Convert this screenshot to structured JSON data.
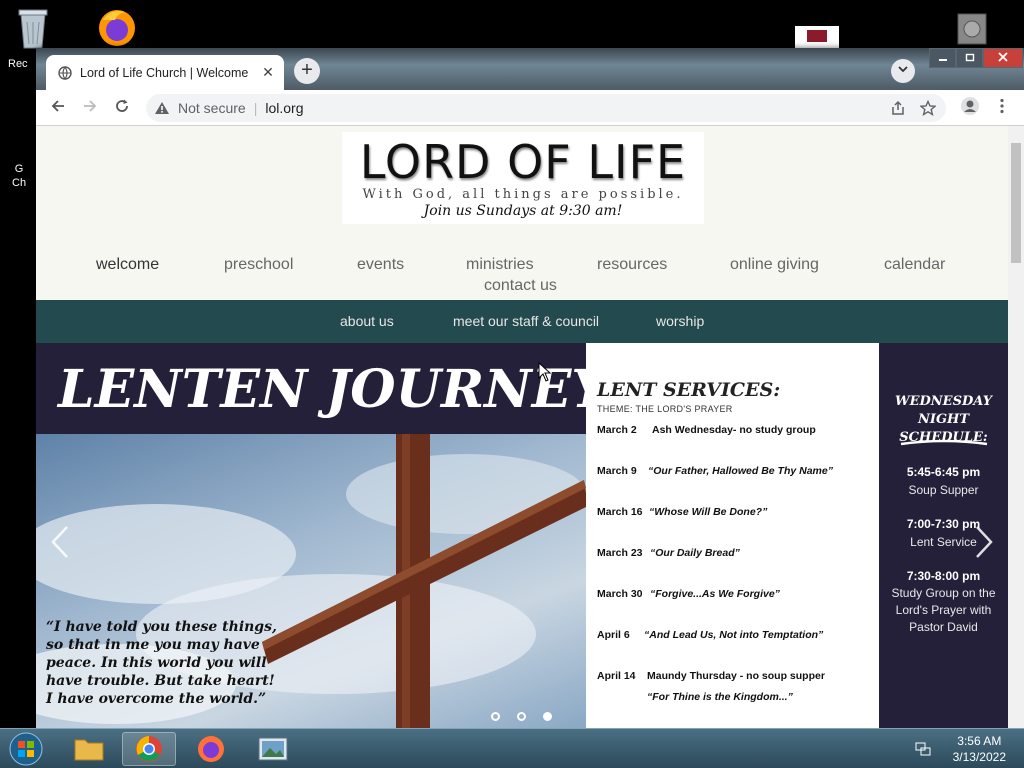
{
  "desktop": {
    "icons": [
      {
        "label": "Rec"
      },
      {
        "label": "G\nCh"
      }
    ]
  },
  "browser": {
    "tab_title": "Lord of Life Church | Welcome",
    "address_security": "Not secure",
    "address_url": "lol.org"
  },
  "site": {
    "logo_title": "LORD OF LIFE",
    "logo_tagline": "With God, all things are possible.",
    "logo_join": "Join us Sundays at 9:30 am!",
    "nav": [
      "welcome",
      "preschool",
      "events",
      "ministries",
      "resources",
      "online giving",
      "calendar",
      "contact us"
    ],
    "subnav": [
      "about us",
      "meet our staff & council",
      "worship"
    ]
  },
  "slide": {
    "heading": "LENTEN JOURNEY",
    "quote": "“I have told you these things, so that in me you may have peace. In this world you will have trouble. But take heart! I have overcome the world.”",
    "lent_heading": "LENT SERVICES:",
    "lent_theme": "THEME: THE LORD'S PRAYER",
    "services": [
      {
        "date": "March 2",
        "title": "Ash Wednesday- no study group"
      },
      {
        "date": "March 9",
        "title": "“Our Father, Hallowed Be Thy Name”"
      },
      {
        "date": "March 16",
        "title": "“Whose Will Be Done?”"
      },
      {
        "date": "March 23",
        "title": "“Our Daily Bread”"
      },
      {
        "date": "March 30",
        "title": "“Forgive...As We Forgive”"
      },
      {
        "date": "April 6",
        "title": "“And Lead Us, Not into Temptation”"
      },
      {
        "date": "April 14",
        "title": "Maundy Thursday - no soup supper",
        "subtitle": "“For Thine is the Kingdom...”"
      }
    ],
    "wednesday_heading": "WEDNESDAY NIGHT SCHEDULE:",
    "schedule": [
      {
        "time": "5:45-6:45 pm",
        "desc": "Soup Supper"
      },
      {
        "time": "7:00-7:30 pm",
        "desc": "Lent Service"
      },
      {
        "time": "7:30-8:00 pm",
        "desc": "Study Group on the Lord's Prayer with Pastor David"
      }
    ],
    "slide_count": 3,
    "active_slide": 3
  },
  "taskbar": {
    "time": "3:56 AM",
    "date": "3/13/2022"
  },
  "colors": {
    "nav_bar": "#234a4e",
    "slide_dark": "#242039",
    "page_bg": "#f7f7f2"
  }
}
